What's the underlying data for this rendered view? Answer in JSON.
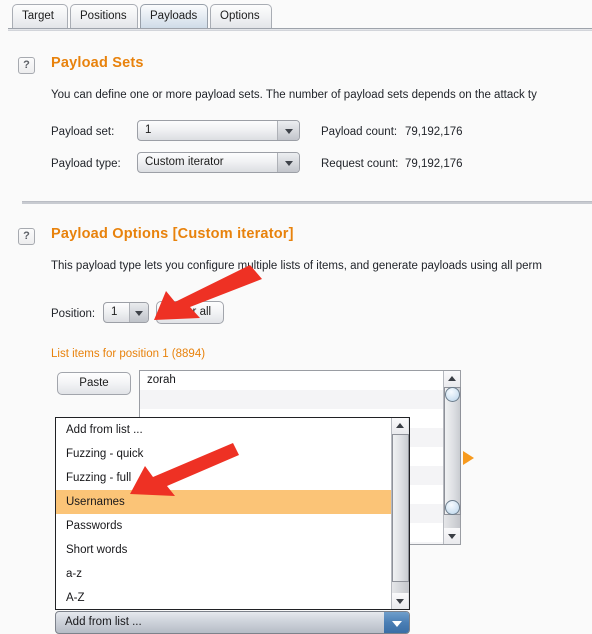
{
  "window": {
    "title": "Payloads"
  },
  "tabs": [
    {
      "label": "Target",
      "active": false
    },
    {
      "label": "Positions",
      "active": false
    },
    {
      "label": "Payloads",
      "active": true
    },
    {
      "label": "Options",
      "active": false
    }
  ],
  "payload_sets": {
    "help_icon": "question-mark-icon",
    "help_label": "?",
    "title": "Payload Sets",
    "description": "You can define one or more payload sets. The number of payload sets depends on the attack ty",
    "payload_set_label": "Payload set:",
    "payload_set_value": "1",
    "payload_type_label": "Payload type:",
    "payload_type_value": "Custom iterator",
    "payload_count_label": "Payload count:",
    "payload_count_value": "79,192,176",
    "request_count_label": "Request count:",
    "request_count_value": "79,192,176"
  },
  "payload_options": {
    "help_icon": "question-mark-icon",
    "help_label": "?",
    "title": "Payload Options [Custom iterator]",
    "description": "This payload type lets you configure multiple lists of items, and generate payloads using all perm",
    "position_label": "Position:",
    "position_value": "1",
    "clear_all_label": "Clear all",
    "list_items_label": "List items for position 1 (8894)",
    "paste_label": "Paste",
    "list_first_item": "zorah",
    "add_from_list_label": "Add from list ..."
  },
  "dropdown": {
    "open": true,
    "selected": "Usernames",
    "items": [
      "Add from list ...",
      "Fuzzing - quick",
      "Fuzzing - full",
      "Usernames",
      "Passwords",
      "Short words",
      "a-z",
      "A-Z"
    ]
  },
  "annotations": {
    "arrow_1_target": "position-dropdown-arrow",
    "arrow_2_target": "dropdown-item-usernames",
    "arrow_color": "#ee3124"
  },
  "markers": {
    "orange_triangle": "orange-play-marker"
  },
  "colors": {
    "accent_orange": "#e8820c",
    "highlight_row": "#fbc477",
    "page_bg": "#fafafa",
    "text": "#22252b",
    "blue_button": "#4b7fb5"
  }
}
